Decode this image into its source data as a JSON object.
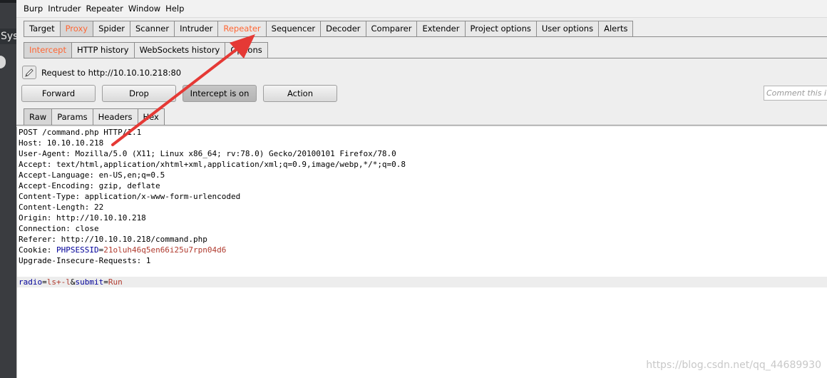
{
  "desktop": {
    "side_label": "Sys"
  },
  "menubar": [
    "Burp",
    "Intruder",
    "Repeater",
    "Window",
    "Help"
  ],
  "main_tabs": [
    "Target",
    "Proxy",
    "Spider",
    "Scanner",
    "Intruder",
    "Repeater",
    "Sequencer",
    "Decoder",
    "Comparer",
    "Extender",
    "Project options",
    "User options",
    "Alerts"
  ],
  "proxy_tabs": [
    "Intercept",
    "HTTP history",
    "WebSockets history",
    "Options"
  ],
  "request": {
    "label": "Request to http://10.10.10.218:80"
  },
  "buttons": {
    "forward": "Forward",
    "drop": "Drop",
    "intercept": "Intercept is on",
    "action": "Action"
  },
  "comment": {
    "placeholder": "Comment this i"
  },
  "view_tabs": [
    "Raw",
    "Params",
    "Headers",
    "Hex"
  ],
  "raw": {
    "lines": [
      "POST /command.php HTTP/1.1",
      "Host: 10.10.10.218",
      "User-Agent: Mozilla/5.0 (X11; Linux x86_64; rv:78.0) Gecko/20100101 Firefox/78.0",
      "Accept: text/html,application/xhtml+xml,application/xml;q=0.9,image/webp,*/*;q=0.8",
      "Accept-Language: en-US,en;q=0.5",
      "Accept-Encoding: gzip, deflate",
      "Content-Type: application/x-www-form-urlencoded",
      "Content-Length: 22",
      "Origin: http://10.10.10.218",
      "Connection: close",
      "Referer: http://10.10.10.218/command.php"
    ],
    "cookie": {
      "prefix": "Cookie: ",
      "name": "PHPSESSID",
      "eq": "=",
      "value": "21oluh46q5en66i25u7rpn04d6"
    },
    "upgrade": "Upgrade-Insecure-Requests: 1",
    "body": {
      "p1": "radio",
      "eq1": "=",
      "v1": "ls+-l",
      "amp": "&",
      "p2": "submit",
      "eq2": "=",
      "v2": "Run"
    }
  },
  "watermark": "https://blog.csdn.net/qq_44689930",
  "colors": {
    "accent": "#ff6633",
    "arrow": "#e53935",
    "param_name": "#000099",
    "param_value": "#b03a2e"
  }
}
